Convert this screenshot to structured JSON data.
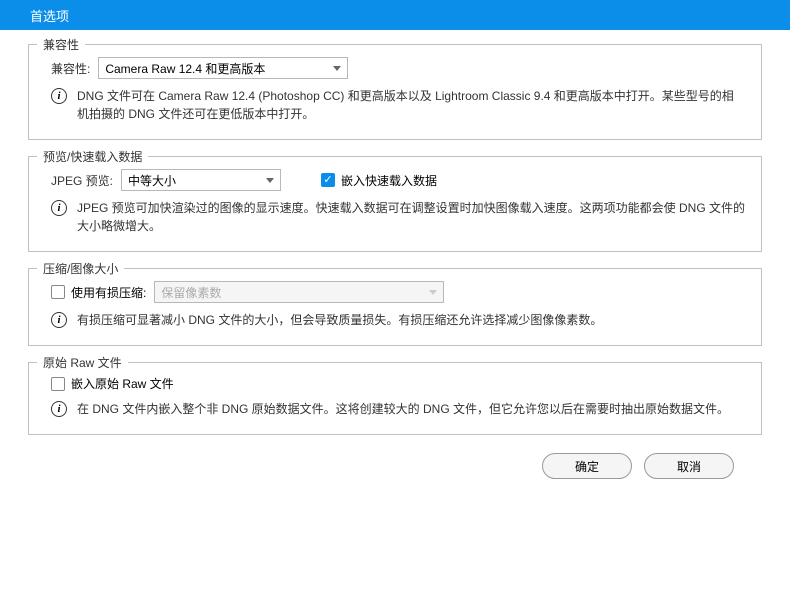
{
  "title": "首选项",
  "compatibility": {
    "legend": "兼容性",
    "label": "兼容性:",
    "value": "Camera Raw 12.4 和更高版本",
    "info": "DNG 文件可在 Camera Raw 12.4 (Photoshop CC) 和更高版本以及 Lightroom Classic 9.4 和更高版本中打开。某些型号的相机拍摄的 DNG 文件还可在更低版本中打开。"
  },
  "preview": {
    "legend": "预览/快速载入数据",
    "jpeg_label": "JPEG 预览:",
    "jpeg_value": "中等大小",
    "embed_label": "嵌入快速载入数据",
    "info": "JPEG 预览可加快渲染过的图像的显示速度。快速载入数据可在调整设置时加快图像载入速度。这两项功能都会使 DNG 文件的大小略微增大。"
  },
  "compression": {
    "legend": "压缩/图像大小",
    "lossy_label": "使用有损压缩:",
    "preserve_value": "保留像素数",
    "info": "有损压缩可显著减小 DNG 文件的大小，但会导致质量损失。有损压缩还允许选择减少图像像素数。"
  },
  "raw": {
    "legend": "原始 Raw 文件",
    "embed_label": "嵌入原始 Raw 文件",
    "info": "在 DNG 文件内嵌入整个非 DNG 原始数据文件。这将创建较大的 DNG 文件，但它允许您以后在需要时抽出原始数据文件。"
  },
  "buttons": {
    "ok": "确定",
    "cancel": "取消"
  }
}
